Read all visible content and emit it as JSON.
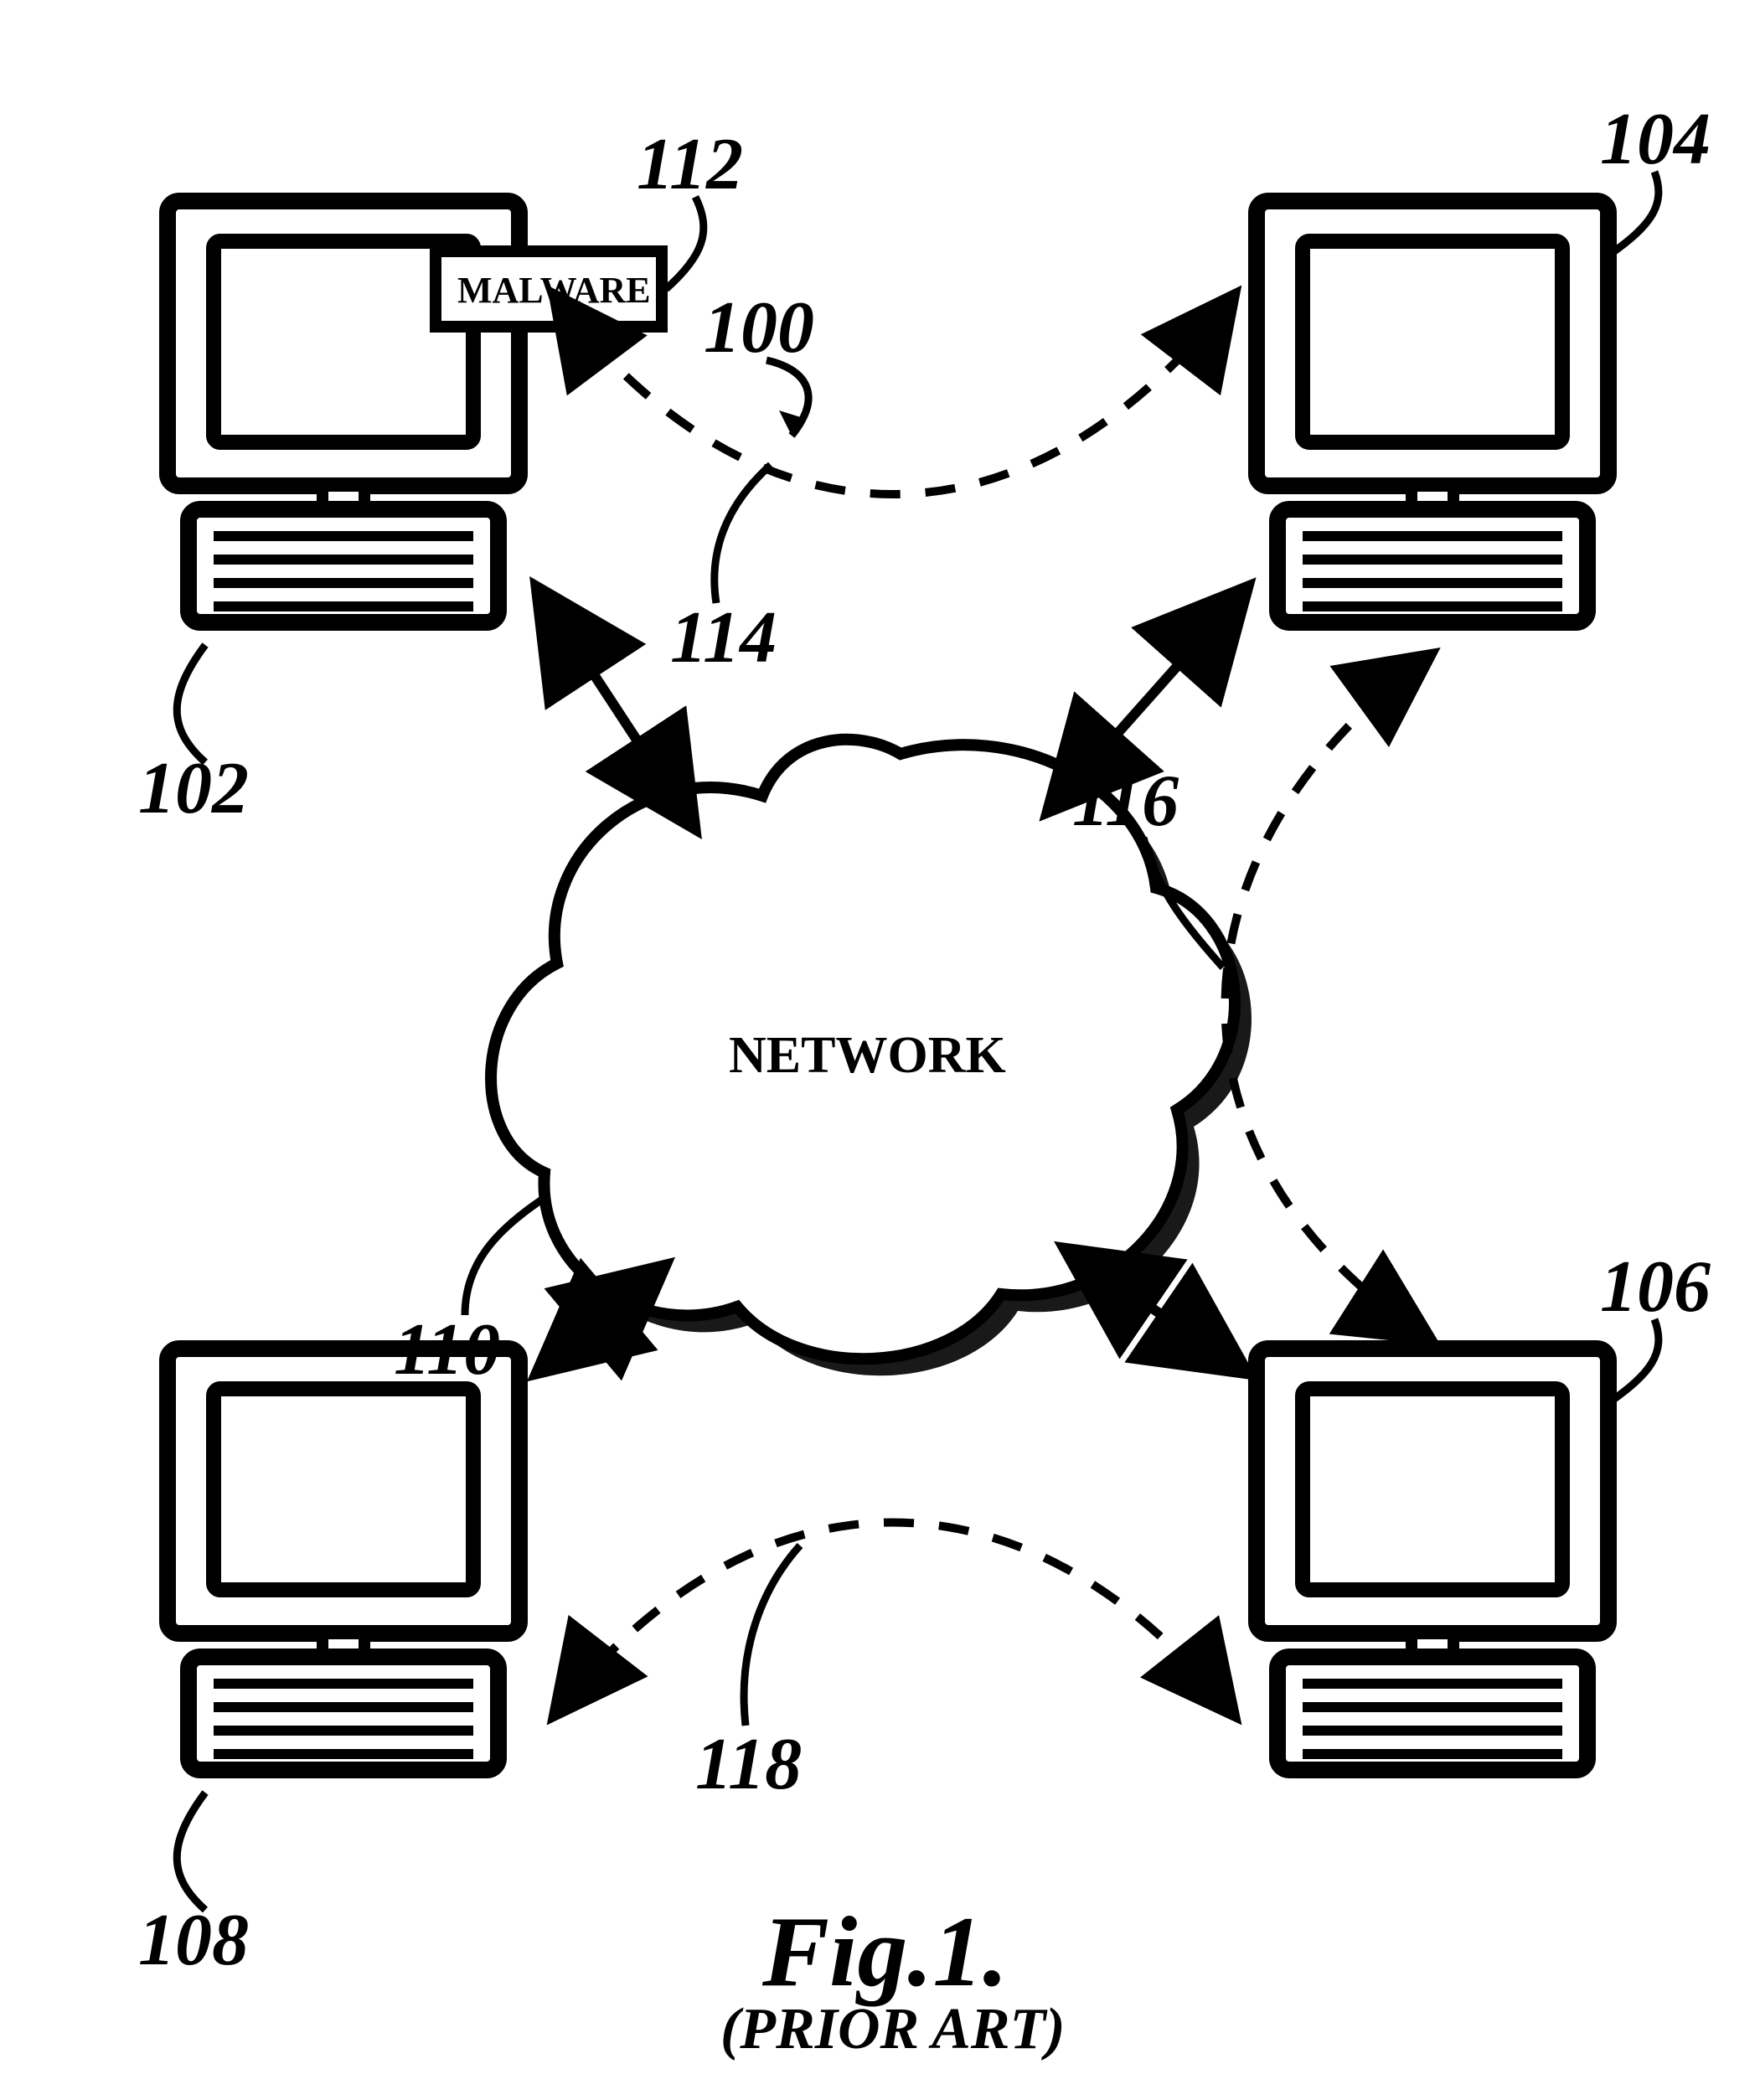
{
  "diagram": {
    "title": "Fig.1.",
    "subtitle": "(PRIOR ART)",
    "network_label": "NETWORK",
    "malware_label": "MALWARE",
    "refs": {
      "system": "100",
      "pc_tl": "102",
      "pc_tr": "104",
      "pc_br": "106",
      "pc_bl": "108",
      "cloud": "110",
      "malware": "112",
      "path_tl": "114",
      "path_tr": "116",
      "path_br": "118"
    }
  }
}
